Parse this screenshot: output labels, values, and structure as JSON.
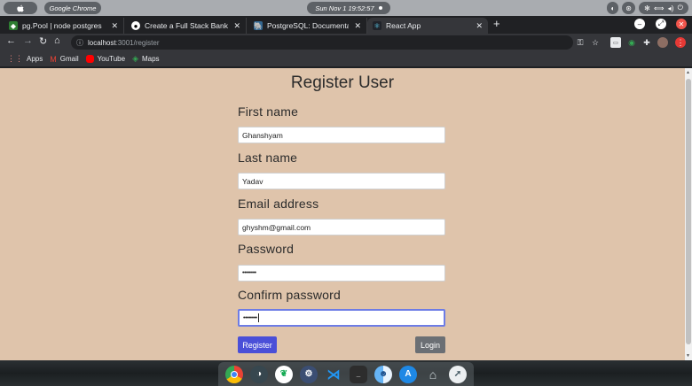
{
  "menubar": {
    "app_name": "Google Chrome",
    "datetime": "Sun Nov 1  19:52:57"
  },
  "tabs": [
    {
      "title": "pg.Pool | node postgres",
      "icon": "node-postgres-favicon",
      "active": false
    },
    {
      "title": "Create a Full Stack Banking",
      "icon": "medium-favicon",
      "active": false
    },
    {
      "title": "PostgreSQL: Documentation",
      "icon": "postgresql-favicon",
      "active": false
    },
    {
      "title": "React App",
      "icon": "react-favicon",
      "active": true
    }
  ],
  "address_bar": {
    "host": "localhost",
    "path": ":3001/register"
  },
  "bookmarks": [
    {
      "label": "Apps",
      "icon": "apps-grid-icon",
      "color": "#f28b82"
    },
    {
      "label": "Gmail",
      "icon": "gmail-icon",
      "color": "#ea4335"
    },
    {
      "label": "YouTube",
      "icon": "youtube-icon",
      "color": "#ff0000"
    },
    {
      "label": "Maps",
      "icon": "maps-icon",
      "color": "#34a853"
    }
  ],
  "form": {
    "title": "Register User",
    "first_name_label": "First name",
    "first_name_value": "Ghanshyam",
    "last_name_label": "Last name",
    "last_name_value": "Yadav",
    "email_label": "Email address",
    "email_value": "ghyshm@gmail.com",
    "password_label": "Password",
    "password_value": "••••••••",
    "confirm_label": "Confirm password",
    "confirm_value": "••••••••",
    "register_label": "Register",
    "login_label": "Login"
  },
  "colors": {
    "page_bg": "#dfc4ab",
    "register_button": "#4a4fd8",
    "login_button": "#6b6f74",
    "focus_ring": "#6d7ce5"
  },
  "dock": [
    "chrome-icon",
    "pgadmin-icon",
    "mongodb-icon",
    "postman-icon",
    "vscode-icon",
    "terminal-icon",
    "finder-icon",
    "app-store-icon",
    "trash-icon",
    "launchpad-icon"
  ]
}
